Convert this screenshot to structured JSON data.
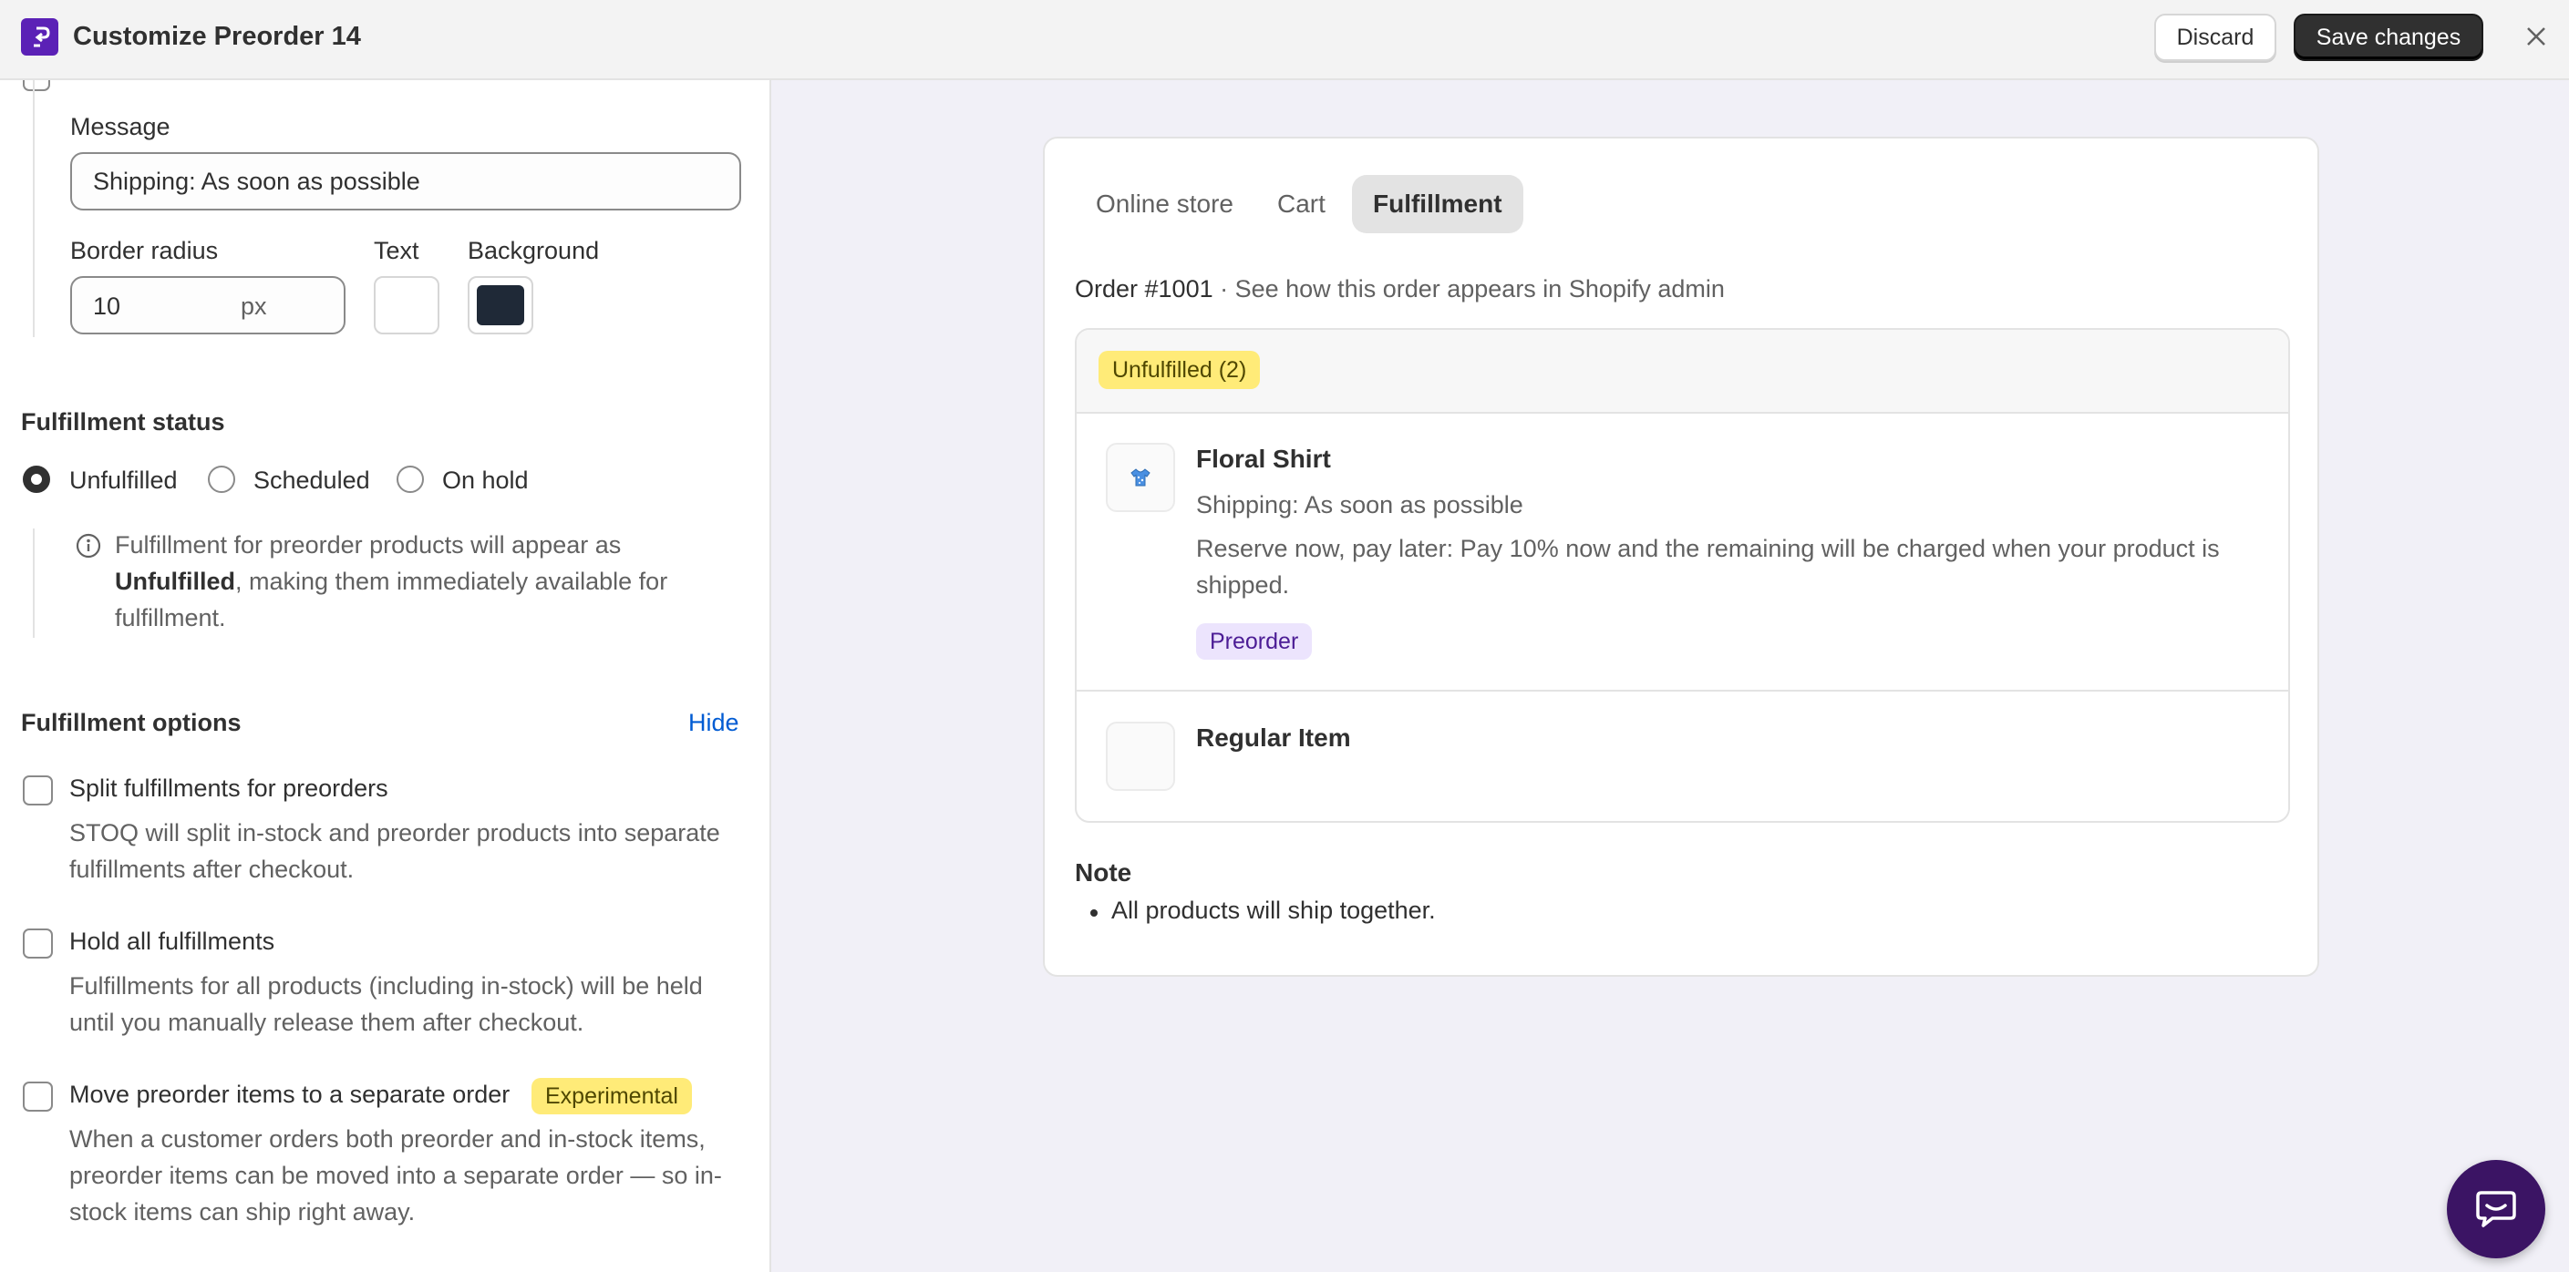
{
  "header": {
    "title": "Customize Preorder 14",
    "discard_label": "Discard",
    "save_label": "Save changes",
    "brand_color": "#5b21b6"
  },
  "badge_settings": {
    "message_label": "Message",
    "message_value": "Shipping: As soon as possible",
    "border_radius_label": "Border radius",
    "border_radius_value": "10",
    "border_radius_unit": "px",
    "text_color_label": "Text",
    "text_color": "#ffffff",
    "background_label": "Background",
    "background_color": "#1f2937"
  },
  "fulfillment_status": {
    "title": "Fulfillment status",
    "options": [
      "Unfulfilled",
      "Scheduled",
      "On hold"
    ],
    "selected": "Unfulfilled",
    "info_prefix": "Fulfillment for preorder products will appear as ",
    "info_bold": "Unfulfilled",
    "info_suffix": ", making them immediately available for fulfillment."
  },
  "fulfillment_options": {
    "title": "Fulfillment options",
    "hide_label": "Hide",
    "items": [
      {
        "label": "Split fulfillments for preorders",
        "description": "STOQ will split in-stock and preorder products into separate fulfillments after checkout.",
        "checked": false
      },
      {
        "label": "Hold all fulfillments",
        "description": "Fulfillments for all products (including in-stock) will be held until you manually release them after checkout.",
        "checked": false
      },
      {
        "label": "Move preorder items to a separate order",
        "badge": "Experimental",
        "description": "When a customer orders both preorder and in-stock items, preorder items can be moved into a separate order — so in-stock items can ship right away.",
        "checked": false
      }
    ]
  },
  "preview": {
    "tabs": [
      "Online store",
      "Cart",
      "Fulfillment"
    ],
    "active_tab": "Fulfillment",
    "order_number": "Order #1001",
    "order_separator": " · ",
    "order_hint": "See how this order appears in Shopify admin",
    "status_badge": "Unfulfilled (2)",
    "items": [
      {
        "name": "Floral Shirt",
        "icon": "shirt-icon",
        "shipping": "Shipping: As soon as possible",
        "terms": "Reserve now, pay later: Pay 10% now and the remaining will be charged when your product is shipped.",
        "badge": "Preorder"
      },
      {
        "name": "Regular Item"
      }
    ],
    "note_title": "Note",
    "note_items": [
      "All products will ship together."
    ]
  }
}
